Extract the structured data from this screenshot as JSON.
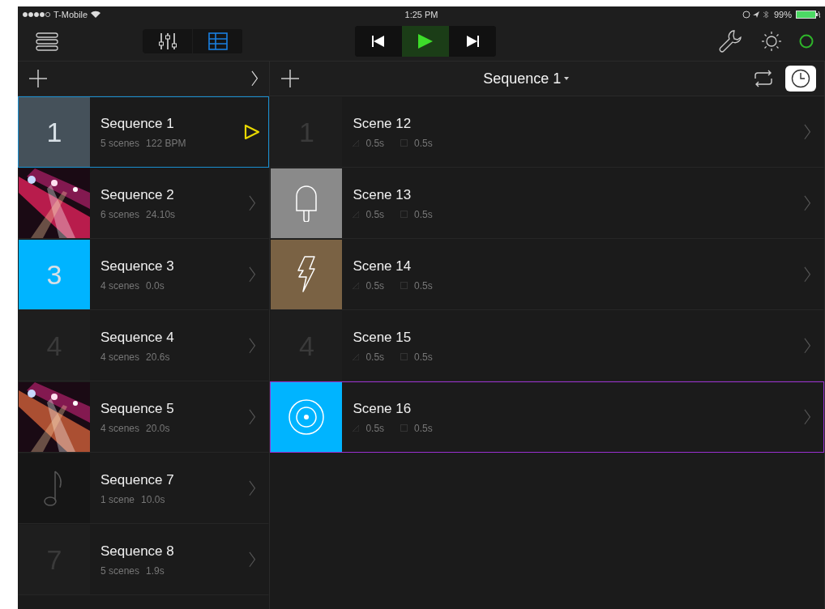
{
  "status_bar": {
    "carrier": "T-Mobile",
    "time": "1:25 PM",
    "battery": "99%"
  },
  "toolbar": {
    "views": [
      {
        "kind": "mixer",
        "selected": false
      },
      {
        "kind": "grid",
        "selected": true
      }
    ],
    "transport": {
      "playing": true
    }
  },
  "sequence_panel": {
    "items": [
      {
        "title": "Sequence 1",
        "meta": [
          "5 scenes",
          "122 BPM"
        ],
        "thumb": {
          "kind": "number",
          "label": "1",
          "color": "#45515a"
        },
        "selected": true,
        "playing": true
      },
      {
        "title": "Sequence 2",
        "meta": [
          "6 scenes",
          "24.10s"
        ],
        "selected": false,
        "playing": false
      },
      {
        "title": "Sequence 3",
        "meta": [
          "4 scenes",
          "0.0s"
        ],
        "thumb": {
          "kind": "number",
          "label": "3",
          "color": "#00b4ff"
        },
        "selected": false,
        "playing": false
      },
      {
        "title": "Sequence 4",
        "meta": [
          "4 scenes",
          "20.6s"
        ],
        "thumb": {
          "kind": "number",
          "label": "4",
          "color": "#1e1e1e"
        },
        "selected": false,
        "playing": false
      },
      {
        "title": "Sequence 5",
        "meta": [
          "4 scenes",
          "20.0s"
        ],
        "selected": false,
        "playing": false
      },
      {
        "title": "Sequence 7",
        "meta": [
          "1 scene",
          "10.0s"
        ],
        "thumb": {
          "kind": "note",
          "color": "#161616"
        },
        "selected": false,
        "playing": false
      },
      {
        "title": "Sequence 8",
        "meta": [
          "5 scenes",
          "1.9s"
        ],
        "thumb": {
          "kind": "number",
          "label": "7",
          "color": "#1e1e1e"
        },
        "selected": false,
        "playing": false
      }
    ]
  },
  "scene_panel": {
    "title": "Sequence 1",
    "loop": false,
    "timer": {
      "selected": true
    },
    "items": [
      {
        "title": "Scene 12",
        "fade": "0.5s",
        "hold": "0.5s",
        "thumb": {
          "kind": "number",
          "label": "1",
          "color": "#1e1e1e"
        },
        "selected": false
      },
      {
        "title": "Scene 13",
        "fade": "0.5s",
        "hold": "0.5s",
        "thumb": {
          "kind": "popsicle",
          "color": "#8a8a8a"
        },
        "selected": false
      },
      {
        "title": "Scene 14",
        "fade": "0.5s",
        "hold": "0.5s",
        "thumb": {
          "kind": "bolt",
          "color": "#7a6244"
        },
        "selected": false
      },
      {
        "title": "Scene 15",
        "fade": "0.5s",
        "hold": "0.5s",
        "thumb": {
          "kind": "number",
          "label": "4",
          "color": "#1e1e1e"
        },
        "selected": false
      },
      {
        "title": "Scene 16",
        "fade": "0.5s",
        "hold": "0.5s",
        "thumb": {
          "kind": "target",
          "color": "#00b4ff"
        },
        "selected": true
      }
    ]
  }
}
